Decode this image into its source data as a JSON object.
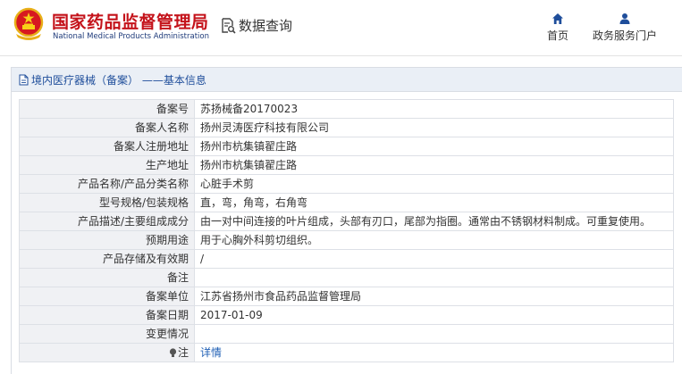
{
  "site": {
    "title_cn": "国家药品监督管理局",
    "title_en": "National Medical Products Administration",
    "section": "数据查询"
  },
  "nav": {
    "home": "首页",
    "gov": "政务服务门户"
  },
  "panel": {
    "title": "境内医疗器械（备案） ——基本信息"
  },
  "record": [
    {
      "label": "备案号",
      "value": "苏扬械备20170023"
    },
    {
      "label": "备案人名称",
      "value": "扬州灵涛医疗科技有限公司"
    },
    {
      "label": "备案人注册地址",
      "value": "扬州市杭集镇翟庄路"
    },
    {
      "label": "生产地址",
      "value": "扬州市杭集镇翟庄路"
    },
    {
      "label": "产品名称/产品分类名称",
      "value": "心脏手术剪"
    },
    {
      "label": "型号规格/包装规格",
      "value": "直，弯，角弯，右角弯"
    },
    {
      "label": "产品描述/主要组成成分",
      "value": "由一对中间连接的叶片组成，头部有刃口，尾部为指圈。通常由不锈钢材料制成。可重复使用。"
    },
    {
      "label": "预期用途",
      "value": "用于心胸外科剪切组织。"
    },
    {
      "label": "产品存储及有效期",
      "value": "/"
    },
    {
      "label": "备注",
      "value": ""
    },
    {
      "label": "备案单位",
      "value": "江苏省扬州市食品药品监督管理局"
    },
    {
      "label": "备案日期",
      "value": "2017-01-09"
    },
    {
      "label": "变更情况",
      "value": ""
    },
    {
      "label": "注",
      "value": "详情"
    }
  ],
  "icons": {
    "emblem": "national-emblem-icon",
    "query": "document-search-icon",
    "home": "home-icon",
    "user": "user-icon",
    "doc": "document-icon",
    "bulb": "lightbulb-icon"
  },
  "colors": {
    "brand_red": "#c4121a",
    "brand_blue": "#1f4e9b",
    "link": "#1f5fb5"
  }
}
